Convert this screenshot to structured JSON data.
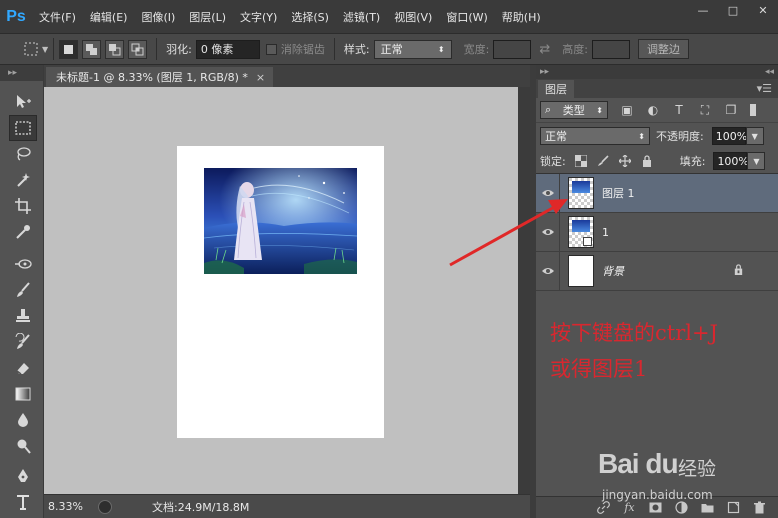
{
  "app": {
    "logo": "Ps",
    "menu": [
      "文件(F)",
      "编辑(E)",
      "图像(I)",
      "图层(L)",
      "文字(Y)",
      "选择(S)",
      "滤镜(T)",
      "视图(V)",
      "窗口(W)",
      "帮助(H)"
    ],
    "window_controls": [
      "—",
      "□",
      "✕"
    ]
  },
  "options": {
    "feather_label": "羽化:",
    "feather_value": "0 像素",
    "antialias_label": "消除锯齿",
    "style_label": "样式:",
    "style_value": "正常",
    "width_label": "宽度:",
    "height_label": "高度:",
    "refine_edge_button": "调整边"
  },
  "document": {
    "tab_title": "未标题-1 @ 8.33% (图层 1, RGB/8) *",
    "tab_close": "×",
    "zoom": "8.33%",
    "doc_size": "文档:24.9M/18.8M"
  },
  "layers_panel": {
    "tab_label": "图层",
    "filter_kind": "类型",
    "blend_mode": "正常",
    "opacity_label": "不透明度:",
    "opacity_value": "100%",
    "lock_label": "锁定:",
    "fill_label": "填充:",
    "fill_value": "100%",
    "layers": [
      {
        "name": "图层 1",
        "selected": true,
        "visible": true
      },
      {
        "name": "1",
        "selected": false,
        "visible": true
      },
      {
        "name": "背景",
        "selected": false,
        "visible": true,
        "locked": true
      }
    ],
    "footer_icons": [
      "link-icon",
      "fx-icon",
      "mask-icon",
      "adjustment-icon",
      "folder-icon",
      "new-layer-icon",
      "trash-icon"
    ],
    "footer_fx": "fx"
  },
  "annotation": {
    "line1": "按下键盘的ctrl+J",
    "line2": "或得图层1",
    "color": "#d9272f"
  },
  "watermark": {
    "brand": "Bai du",
    "sub": "经验",
    "url": "jingyan.baidu.com"
  },
  "colors": {
    "menubar": "#3a3a3a",
    "panel": "#535353",
    "canvas_bg": "#c0c0c0",
    "selected_layer": "#5f6b7c",
    "accent": "#31a8ff"
  }
}
